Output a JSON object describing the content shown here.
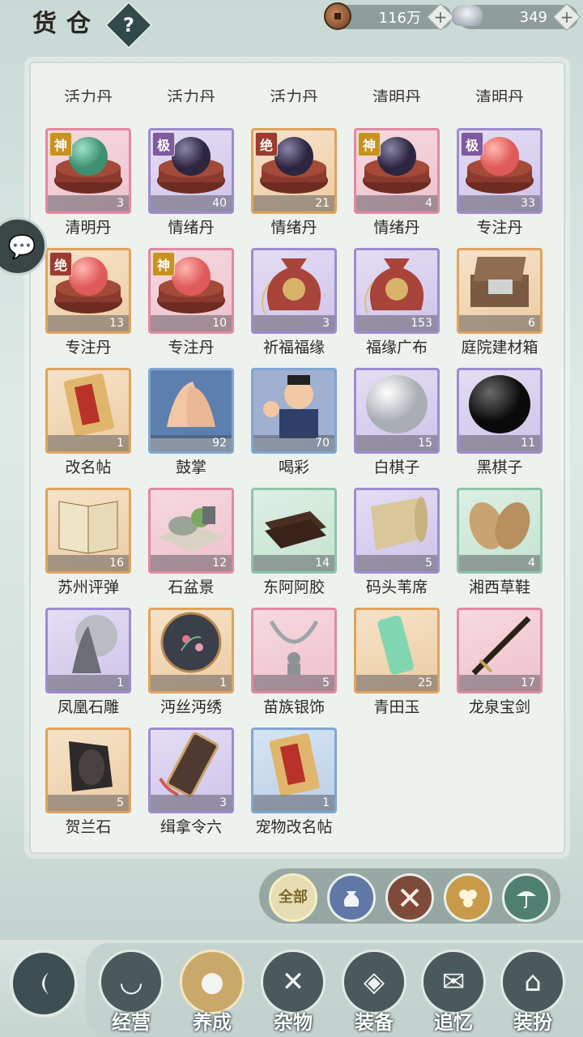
{
  "header": {
    "title": "货仓",
    "help_label": "?",
    "copper": {
      "amount": "116万",
      "plus": "+"
    },
    "silver": {
      "amount": "349",
      "plus": "+"
    }
  },
  "side": {
    "chat_icon": "chat-icon"
  },
  "inventory": {
    "partial_labels": [
      "活力丹",
      "活力丹",
      "活力丹",
      "清明丹",
      "清明丹"
    ],
    "items": [
      {
        "name": "清明丹",
        "count": "3",
        "badge": "神",
        "art": "orb-green",
        "quality": "red"
      },
      {
        "name": "情绪丹",
        "count": "40",
        "badge": "极",
        "art": "orb-dark",
        "quality": "purple"
      },
      {
        "name": "情绪丹",
        "count": "21",
        "badge": "绝",
        "art": "orb-dark",
        "quality": "orange"
      },
      {
        "name": "情绪丹",
        "count": "4",
        "badge": "神",
        "art": "orb-dark",
        "quality": "red"
      },
      {
        "name": "专注丹",
        "count": "33",
        "badge": "极",
        "art": "orb-red",
        "quality": "purple"
      },
      {
        "name": "专注丹",
        "count": "13",
        "badge": "绝",
        "art": "orb-red",
        "quality": "orange"
      },
      {
        "name": "专注丹",
        "count": "10",
        "badge": "神",
        "art": "orb-red",
        "quality": "red"
      },
      {
        "name": "祈福福缘",
        "count": "3",
        "badge": "",
        "art": "pouch",
        "quality": "purple"
      },
      {
        "name": "福缘广布",
        "count": "153",
        "badge": "",
        "art": "pouch",
        "quality": "purple"
      },
      {
        "name": "庭院建材箱",
        "count": "6",
        "badge": "",
        "art": "box",
        "quality": "orange"
      },
      {
        "name": "改名帖",
        "count": "1",
        "badge": "",
        "art": "card",
        "quality": "orange"
      },
      {
        "name": "鼓掌",
        "count": "92",
        "badge": "",
        "art": "clap",
        "quality": "blue"
      },
      {
        "name": "喝彩",
        "count": "70",
        "badge": "",
        "art": "cheer",
        "quality": "blue"
      },
      {
        "name": "白棋子",
        "count": "15",
        "badge": "",
        "art": "white-stone",
        "quality": "purple"
      },
      {
        "name": "黑棋子",
        "count": "11",
        "badge": "",
        "art": "black-stone",
        "quality": "purple"
      },
      {
        "name": "苏州评弹",
        "count": "16",
        "badge": "",
        "art": "book",
        "quality": "orange"
      },
      {
        "name": "石盆景",
        "count": "12",
        "badge": "",
        "art": "bonsai",
        "quality": "red"
      },
      {
        "name": "东阿阿胶",
        "count": "14",
        "badge": "",
        "art": "gelatin",
        "quality": "green"
      },
      {
        "name": "码头苇席",
        "count": "5",
        "badge": "",
        "art": "mat",
        "quality": "purple"
      },
      {
        "name": "湘西草鞋",
        "count": "4",
        "badge": "",
        "art": "sandals",
        "quality": "green"
      },
      {
        "name": "凤凰石雕",
        "count": "1",
        "badge": "",
        "art": "phoenix",
        "quality": "purple"
      },
      {
        "name": "沔丝沔绣",
        "count": "1",
        "badge": "",
        "art": "embroidery",
        "quality": "orange"
      },
      {
        "name": "苗族银饰",
        "count": "5",
        "badge": "",
        "art": "necklace",
        "quality": "red"
      },
      {
        "name": "青田玉",
        "count": "25",
        "badge": "",
        "art": "jade",
        "quality": "orange"
      },
      {
        "name": "龙泉宝剑",
        "count": "17",
        "badge": "",
        "art": "sword",
        "quality": "red"
      },
      {
        "name": "贺兰石",
        "count": "5",
        "badge": "",
        "art": "inkstone",
        "quality": "orange"
      },
      {
        "name": "缉拿令六",
        "count": "3",
        "badge": "",
        "art": "token",
        "quality": "purple"
      },
      {
        "name": "宠物改名帖",
        "count": "1",
        "badge": "",
        "art": "card",
        "quality": "blue"
      }
    ]
  },
  "filters": [
    {
      "label": "全部",
      "icon": "all-icon"
    },
    {
      "label": "",
      "icon": "pouch-icon"
    },
    {
      "label": "",
      "icon": "tools-icon"
    },
    {
      "label": "",
      "icon": "materials-icon"
    },
    {
      "label": "",
      "icon": "umbrella-icon"
    }
  ],
  "nav": {
    "back_icon": "back-icon",
    "items": [
      {
        "label": "经营",
        "icon": "bowl-icon",
        "active": false
      },
      {
        "label": "养成",
        "icon": "orb-icon",
        "active": true
      },
      {
        "label": "杂物",
        "icon": "sticks-icon",
        "active": false
      },
      {
        "label": "装备",
        "icon": "robe-icon",
        "active": false
      },
      {
        "label": "追忆",
        "icon": "letter-icon",
        "active": false
      },
      {
        "label": "装扮",
        "icon": "pavilion-icon",
        "active": false
      }
    ]
  }
}
